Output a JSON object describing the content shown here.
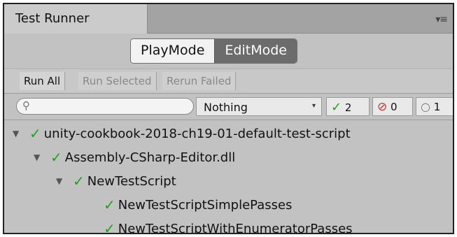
{
  "window": {
    "title": "Test Runner",
    "menu_icon": "▾≡"
  },
  "modes": {
    "play": "PlayMode",
    "edit": "EditMode",
    "selected": "EditMode"
  },
  "toolbar": {
    "run_all": "Run All",
    "run_selected": "Run Selected",
    "rerun_failed": "Rerun Failed"
  },
  "filter": {
    "search_value": "",
    "category": "Nothing",
    "passed_count": "2",
    "failed_count": "0",
    "skipped_count": "1"
  },
  "tree": {
    "items": [
      {
        "label": "unity-cookbook-2018-ch19-01-default-test-script",
        "level": 0,
        "expanded": true,
        "status": "passed"
      },
      {
        "label": "Assembly-CSharp-Editor.dll",
        "level": 1,
        "expanded": true,
        "status": "passed"
      },
      {
        "label": "NewTestScript",
        "level": 2,
        "expanded": true,
        "status": "passed"
      },
      {
        "label": "NewTestScriptSimplePasses",
        "level": 3,
        "status": "passed"
      },
      {
        "label": "NewTestScriptWithEnumeratorPasses",
        "level": 3,
        "status": "passed"
      }
    ]
  },
  "colors": {
    "pass": "#1fa11f",
    "fail": "#d12a2a",
    "selected_mode": "#6c6c6c"
  }
}
